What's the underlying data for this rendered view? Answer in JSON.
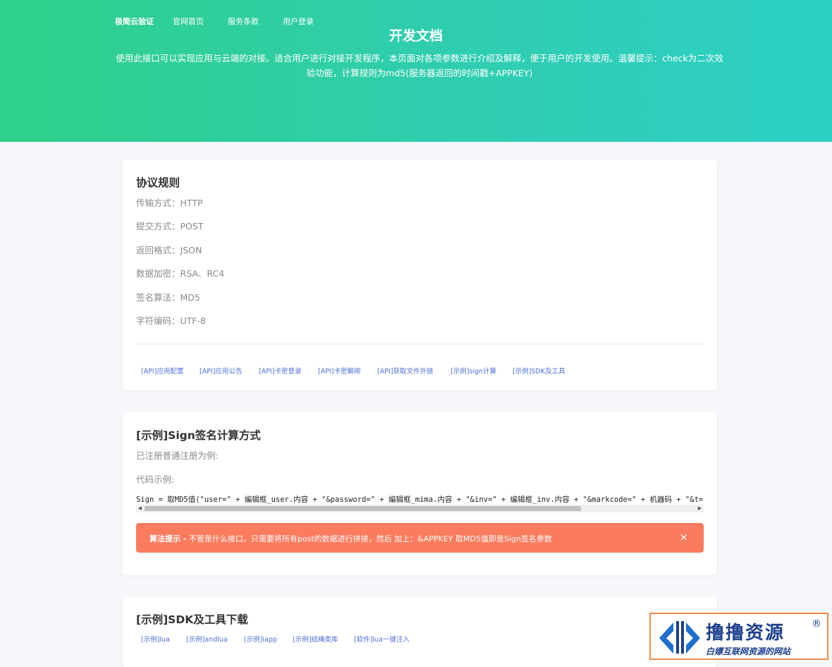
{
  "nav": {
    "brand": "极简云验证",
    "items": [
      "官网首页",
      "服务条款",
      "用户登录"
    ]
  },
  "hero": {
    "title": "开发文档",
    "description": "使用此接口可以实现应用与云端的对接。适合用户进行对接开发程序，本页面对各项参数进行介绍及解释，便于用户的开发使用。温馨提示：check为二次效验功能，计算规则为md5(服务器返回的时间戳+APPKEY)"
  },
  "protocol": {
    "title": "协议规则",
    "props": [
      {
        "label": "传输方式：",
        "value": "HTTP"
      },
      {
        "label": "提交方式：",
        "value": "POST"
      },
      {
        "label": "返回格式：",
        "value": "JSON"
      },
      {
        "label": "数据加密：",
        "value": "RSA、RC4"
      },
      {
        "label": "签名算法：",
        "value": "MD5"
      },
      {
        "label": "字符编码：",
        "value": "UTF-8"
      }
    ],
    "links": [
      "[API]应用配置",
      "[API]应用公告",
      "[API]卡密登录",
      "[API]卡密解绑",
      "[API]获取文件外链",
      "[示例]sign计算",
      "[示例]SDK及工具"
    ]
  },
  "sign": {
    "title": "[示例]Sign签名计算方式",
    "intro": "已注册普通注册为例:",
    "code_label": "代码示例:",
    "code": "Sign = 取MD5值(\"user=\" + 编辑框_user.内容 + \"&password=\" + 编辑框_mima.内容 + \"&inv=\" + 编辑框_inv.内容 + \"&markcode=\" + 机器码 + \"&t=",
    "alert_bold": "算法提示 -",
    "alert_text": " 不管是什么接口，只需要将所有post的数据进行拼接，然后 加上：&APPKEY 取MD5值即是Sign签名参数",
    "close_glyph": "×"
  },
  "sdk": {
    "title": "[示例]SDK及工具下载",
    "links": [
      "[示例]lua",
      "[示例]andlua",
      "[示例]iapp",
      "[示例]结绳类库",
      "[软件]lua一键注入"
    ]
  },
  "watermark": {
    "title": "撸撸资源",
    "registered": "®",
    "subtitle": "白嫖互联网资源的网站"
  },
  "colors": {
    "hero_start": "#2fd08a",
    "hero_end": "#2ed0c6",
    "link": "#4c6fd8",
    "alert": "#fb7b5e"
  }
}
